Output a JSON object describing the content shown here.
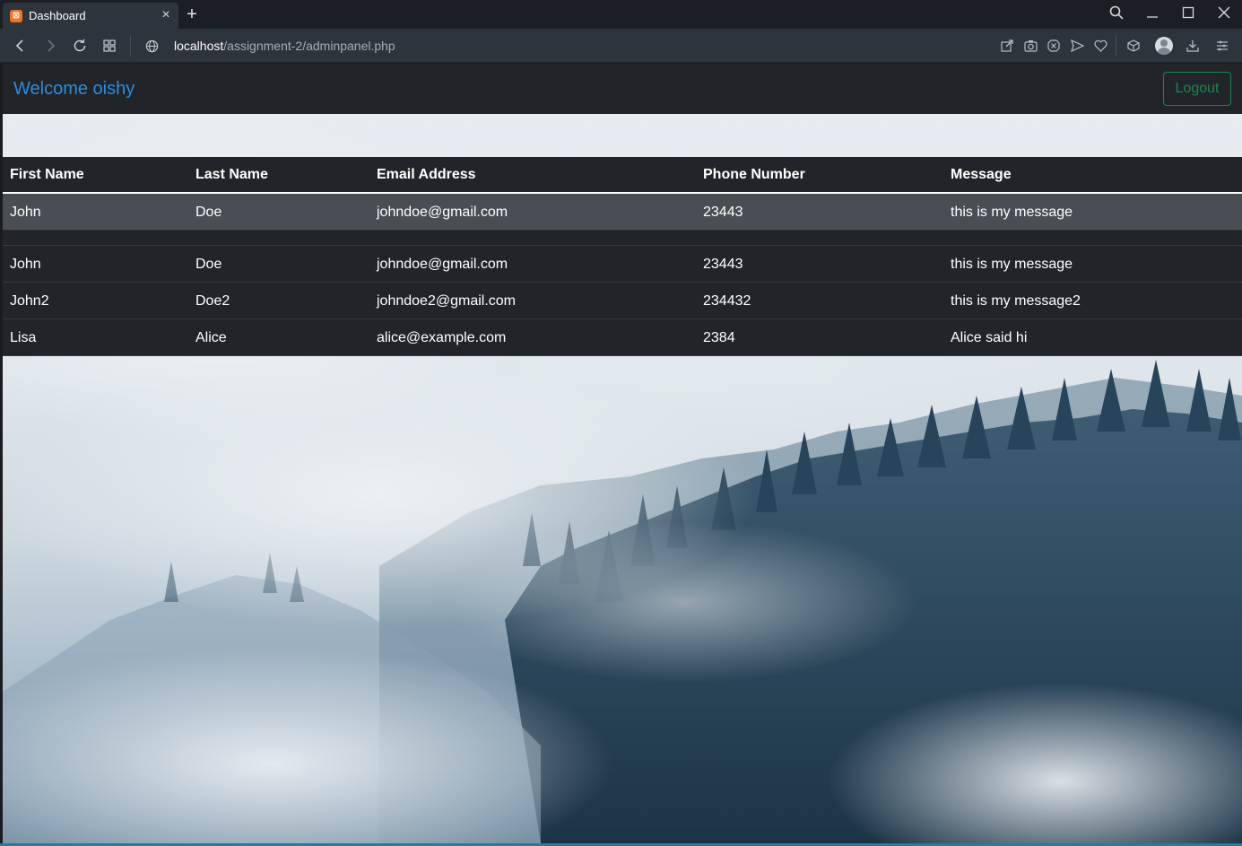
{
  "browser": {
    "tab_title": "Dashboard",
    "url_host": "localhost",
    "url_path": "/assignment-2/adminpanel.php"
  },
  "navbar": {
    "welcome_text": "Welcome oishy",
    "logout_label": "Logout",
    "welcome_color": "#2f8bdb",
    "logout_color": "#198754"
  },
  "table": {
    "headers": {
      "first_name": "First Name",
      "last_name": "Last Name",
      "email": "Email Address",
      "phone": "Phone Number",
      "message": "Message"
    },
    "rows": [
      {
        "first_name": "John",
        "last_name": "Doe",
        "email": "johndoe@gmail.com",
        "phone": "23443",
        "message": "this is my message"
      },
      {
        "first_name": "John",
        "last_name": "Doe",
        "email": "johndoe@gmail.com",
        "phone": "23443",
        "message": "this is my message"
      },
      {
        "first_name": "John2",
        "last_name": "Doe2",
        "email": "johndoe2@gmail.com",
        "phone": "234432",
        "message": "this is my message2"
      },
      {
        "first_name": "Lisa",
        "last_name": "Alice",
        "email": "alice@example.com",
        "phone": "2384",
        "message": "Alice said hi"
      }
    ]
  },
  "icons": {
    "favicon": "xampp-favicon-icon",
    "tab_close": "close-icon",
    "new_tab": "plus-icon",
    "back": "back-arrow-icon",
    "forward": "forward-arrow-icon",
    "reload": "reload-icon",
    "tabs_grid": "tabs-grid-icon",
    "site_info": "globe-icon",
    "search": "search-icon",
    "minimize": "minimize-icon",
    "maximize": "maximize-icon",
    "close_window": "close-window-icon"
  }
}
